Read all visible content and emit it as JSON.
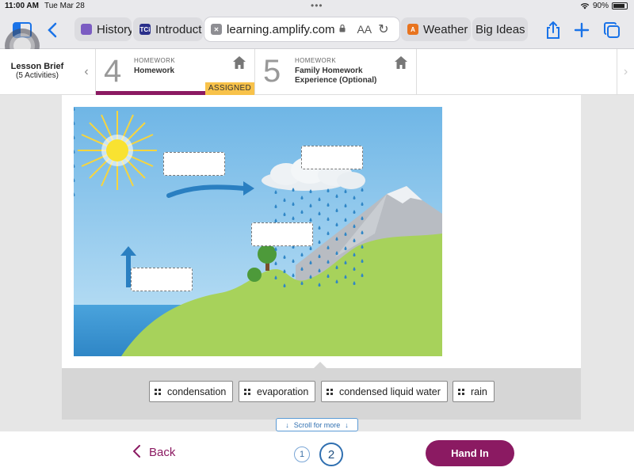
{
  "status": {
    "time": "11:00 AM",
    "date": "Tue Mar 28",
    "battery": "90%"
  },
  "browser": {
    "tabs": [
      {
        "label": "History",
        "favicon": "purple-icon"
      },
      {
        "label": "Introduct",
        "favicon": "tci-icon",
        "favicon_text": "TCi"
      },
      {
        "label": "learning.amplify.com",
        "active": true,
        "favicon": "close-tab-icon"
      },
      {
        "label": "Weather",
        "favicon": "amplify-icon",
        "favicon_text": "A"
      },
      {
        "label": "Big Ideas",
        "favicon": ""
      }
    ],
    "text_size_label": "AA"
  },
  "lesson": {
    "brief_title": "Lesson Brief",
    "brief_count": "(5 Activities)",
    "items": [
      {
        "number": "4",
        "type": "HOMEWORK",
        "name": "Homework",
        "status": "ASSIGNED"
      },
      {
        "number": "5",
        "type": "HOMEWORK",
        "name": "Family Homework Experience (Optional)"
      }
    ]
  },
  "activity": {
    "word_bank": [
      "condensation",
      "evaporation",
      "condensed liquid water",
      "rain"
    ],
    "scroll_hint": "Scroll for more"
  },
  "footer": {
    "back_label": "Back",
    "pages": [
      "1",
      "2"
    ],
    "current_page": "2",
    "hand_in_label": "Hand In"
  },
  "colors": {
    "brand": "#8b1a62",
    "assigned": "#f8c24a",
    "link_blue": "#2f6fb0",
    "sky": "#7ec0ea",
    "grass": "#a7d25b"
  }
}
